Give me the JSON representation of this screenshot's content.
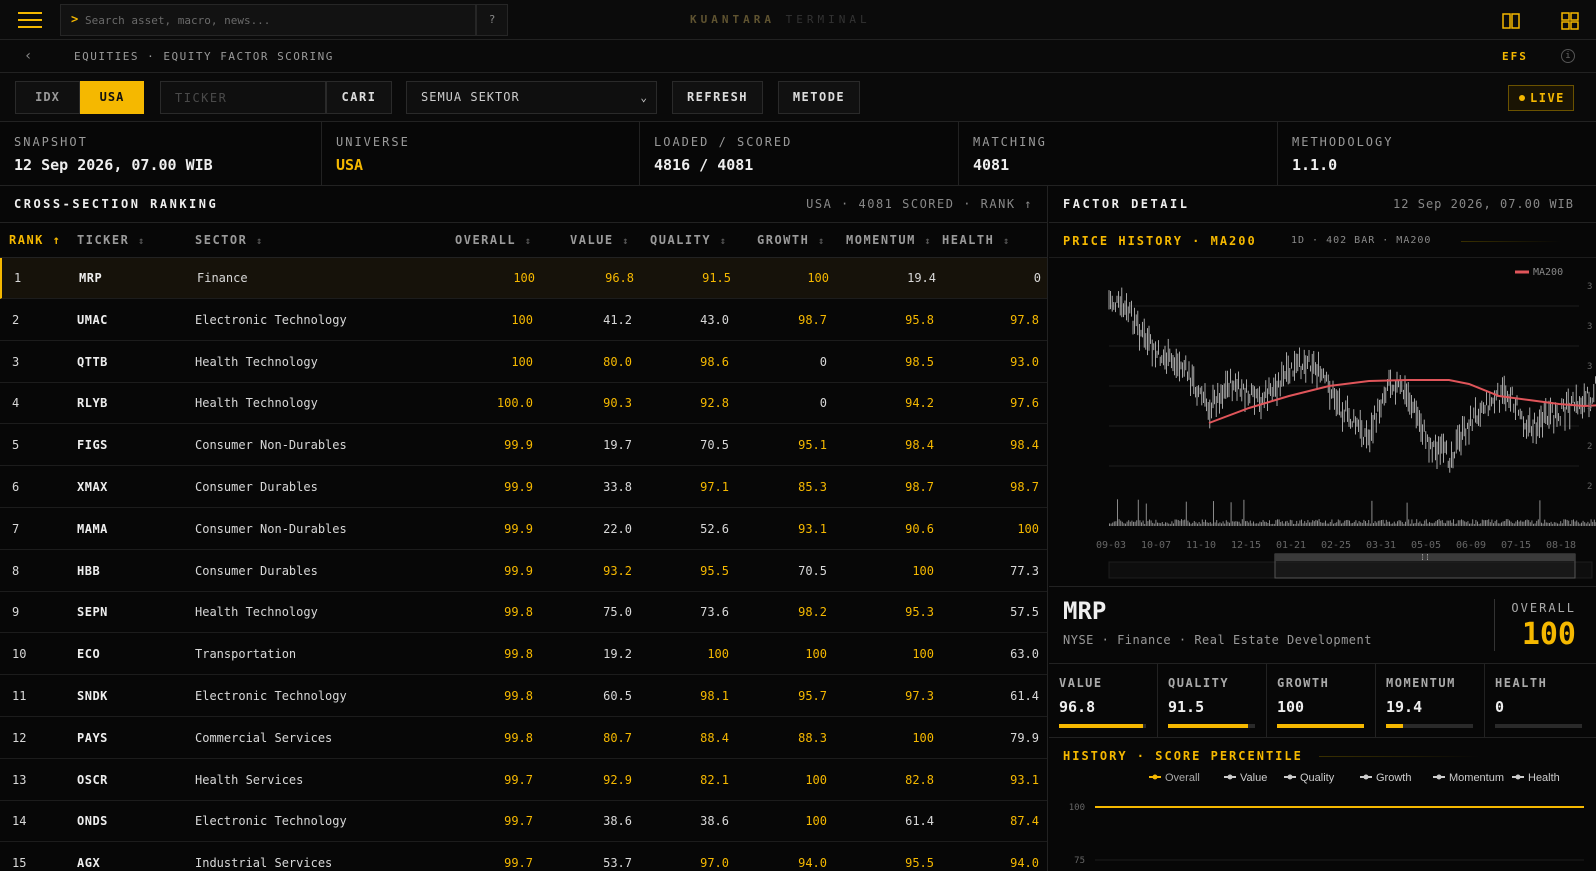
{
  "topbar": {
    "search_placeholder": "Search asset, macro, news...",
    "help_label": "?",
    "brand_primary": "KUANTARA",
    "brand_secondary": "TERMINAL"
  },
  "breadcrumb": {
    "back": "‹",
    "path": "EQUITIES · EQUITY FACTOR SCORING",
    "code": "EFS",
    "info": "i"
  },
  "controls": {
    "markets": [
      "IDX",
      "USA"
    ],
    "active_market": "USA",
    "ticker_placeholder": "TICKER",
    "search_button": "CARI",
    "sector_select": "SEMUA SEKTOR",
    "refresh_button": "REFRESH",
    "method_button": "METODE",
    "live_label": "LIVE"
  },
  "stats": [
    {
      "label": "SNAPSHOT",
      "value": "12 Sep 2026, 07.00 WIB"
    },
    {
      "label": "UNIVERSE",
      "value": "USA"
    },
    {
      "label": "LOADED / SCORED",
      "value": "4816 / 4081"
    },
    {
      "label": "MATCHING",
      "value": "4081"
    },
    {
      "label": "METHODOLOGY",
      "value": "1.1.0"
    }
  ],
  "ranking": {
    "title": "CROSS-SECTION RANKING",
    "meta": "USA · 4081 SCORED · RANK ↑",
    "columns": [
      "RANK",
      "TICKER",
      "SECTOR",
      "OVERALL",
      "VALUE",
      "QUALITY",
      "GROWTH",
      "MOMENTUM",
      "HEALTH"
    ],
    "rows": [
      {
        "rank": "1",
        "ticker": "MRP",
        "sector": "Finance",
        "overall": "100",
        "value": "96.8",
        "quality": "91.5",
        "growth": "100",
        "momentum": "19.4",
        "health": "0"
      },
      {
        "rank": "2",
        "ticker": "UMAC",
        "sector": "Electronic Technology",
        "overall": "100",
        "value": "41.2",
        "quality": "43.0",
        "growth": "98.7",
        "momentum": "95.8",
        "health": "97.8"
      },
      {
        "rank": "3",
        "ticker": "QTTB",
        "sector": "Health Technology",
        "overall": "100",
        "value": "80.0",
        "quality": "98.6",
        "growth": "0",
        "momentum": "98.5",
        "health": "93.0"
      },
      {
        "rank": "4",
        "ticker": "RLYB",
        "sector": "Health Technology",
        "overall": "100.0",
        "value": "90.3",
        "quality": "92.8",
        "growth": "0",
        "momentum": "94.2",
        "health": "97.6"
      },
      {
        "rank": "5",
        "ticker": "FIGS",
        "sector": "Consumer Non-Durables",
        "overall": "99.9",
        "value": "19.7",
        "quality": "70.5",
        "growth": "95.1",
        "momentum": "98.4",
        "health": "98.4"
      },
      {
        "rank": "6",
        "ticker": "XMAX",
        "sector": "Consumer Durables",
        "overall": "99.9",
        "value": "33.8",
        "quality": "97.1",
        "growth": "85.3",
        "momentum": "98.7",
        "health": "98.7"
      },
      {
        "rank": "7",
        "ticker": "MAMA",
        "sector": "Consumer Non-Durables",
        "overall": "99.9",
        "value": "22.0",
        "quality": "52.6",
        "growth": "93.1",
        "momentum": "90.6",
        "health": "100"
      },
      {
        "rank": "8",
        "ticker": "HBB",
        "sector": "Consumer Durables",
        "overall": "99.9",
        "value": "93.2",
        "quality": "95.5",
        "growth": "70.5",
        "momentum": "100",
        "health": "77.3"
      },
      {
        "rank": "9",
        "ticker": "SEPN",
        "sector": "Health Technology",
        "overall": "99.8",
        "value": "75.0",
        "quality": "73.6",
        "growth": "98.2",
        "momentum": "95.3",
        "health": "57.5"
      },
      {
        "rank": "10",
        "ticker": "ECO",
        "sector": "Transportation",
        "overall": "99.8",
        "value": "19.2",
        "quality": "100",
        "growth": "100",
        "momentum": "100",
        "health": "63.0"
      },
      {
        "rank": "11",
        "ticker": "SNDK",
        "sector": "Electronic Technology",
        "overall": "99.8",
        "value": "60.5",
        "quality": "98.1",
        "growth": "95.7",
        "momentum": "97.3",
        "health": "61.4"
      },
      {
        "rank": "12",
        "ticker": "PAYS",
        "sector": "Commercial Services",
        "overall": "99.8",
        "value": "80.7",
        "quality": "88.4",
        "growth": "88.3",
        "momentum": "100",
        "health": "79.9"
      },
      {
        "rank": "13",
        "ticker": "OSCR",
        "sector": "Health Services",
        "overall": "99.7",
        "value": "92.9",
        "quality": "82.1",
        "growth": "100",
        "momentum": "82.8",
        "health": "93.1"
      },
      {
        "rank": "14",
        "ticker": "ONDS",
        "sector": "Electronic Technology",
        "overall": "99.7",
        "value": "38.6",
        "quality": "38.6",
        "growth": "100",
        "momentum": "61.4",
        "health": "87.4"
      },
      {
        "rank": "15",
        "ticker": "AGX",
        "sector": "Industrial Services",
        "overall": "99.7",
        "value": "53.7",
        "quality": "97.0",
        "growth": "94.0",
        "momentum": "95.5",
        "health": "94.0"
      }
    ]
  },
  "detail": {
    "title": "FACTOR DETAIL",
    "timestamp": "12 Sep 2026, 07.00 WIB",
    "price_title": "PRICE HISTORY · MA200",
    "price_meta": "1D · 402 BAR · MA200",
    "legend_ma": "MA200",
    "x_ticks": [
      "09-03",
      "10-07",
      "11-10",
      "12-15",
      "01-21",
      "02-25",
      "03-31",
      "05-05",
      "06-09",
      "07-15",
      "08-18"
    ],
    "y_ticks": [
      "3",
      "3",
      "3",
      "3",
      "2",
      "2"
    ],
    "ticker": "MRP",
    "subtitle": "NYSE · Finance · Real Estate Development",
    "overall_label": "OVERALL",
    "overall_value": "100",
    "factors": [
      {
        "label": "VALUE",
        "value": "96.8",
        "pct": 96.8
      },
      {
        "label": "QUALITY",
        "value": "91.5",
        "pct": 91.5
      },
      {
        "label": "GROWTH",
        "value": "100",
        "pct": 100
      },
      {
        "label": "MOMENTUM",
        "value": "19.4",
        "pct": 19.4
      },
      {
        "label": "HEALTH",
        "value": "0",
        "pct": 0
      }
    ],
    "history_title": "HISTORY · SCORE PERCENTILE",
    "history_legend": [
      "Overall",
      "Value",
      "Quality",
      "Growth",
      "Momentum",
      "Health"
    ],
    "history_y": [
      "100",
      "75"
    ],
    "colors": {
      "accent": "#f5b800",
      "ma": "#e0555a"
    }
  }
}
